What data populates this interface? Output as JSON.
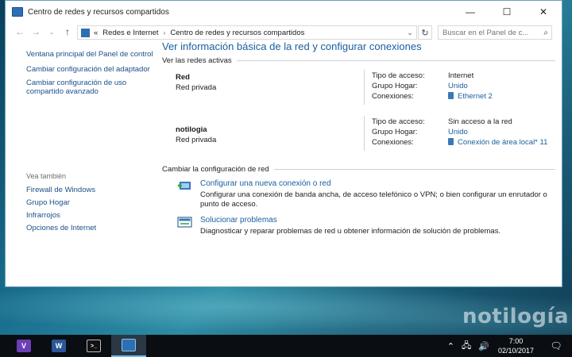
{
  "window": {
    "title": "Centro de redes y recursos compartidos",
    "controls": {
      "minimize": "—",
      "maximize": "☐",
      "close": "✕"
    }
  },
  "address": {
    "prefix": "«",
    "crumbs": [
      "Redes e Internet",
      "Centro de redes y recursos compartidos"
    ],
    "separator": "›",
    "search_placeholder": "Buscar en el Panel de c..."
  },
  "sidebar": {
    "items": [
      {
        "label": "Ventana principal del Panel de control"
      },
      {
        "label": "Cambiar configuración del adaptador"
      },
      {
        "label": "Cambiar configuración de uso compartido avanzado"
      }
    ],
    "see_also_heading": "Vea también",
    "see_also": [
      {
        "label": "Firewall de Windows"
      },
      {
        "label": "Grupo Hogar"
      },
      {
        "label": "Infrarrojos"
      },
      {
        "label": "Opciones de Internet"
      }
    ]
  },
  "main": {
    "heading": "Ver información básica de la red y configurar conexiones",
    "active_networks_heading": "Ver las redes activas",
    "labels": {
      "access_type": "Tipo de acceso:",
      "homegroup": "Grupo Hogar:",
      "connections": "Conexiones:"
    },
    "networks": [
      {
        "name": "Red",
        "type": "Red privada",
        "access": "Internet",
        "homegroup": "Unido",
        "connection": "Ethernet 2"
      },
      {
        "name": "notilogia",
        "type": "Red privada",
        "access": "Sin acceso a la red",
        "homegroup": "Unido",
        "connection": "Conexión de área local* 11"
      }
    ],
    "change_settings_heading": "Cambiar la configuración de red",
    "tasks": [
      {
        "title": "Configurar una nueva conexión o red",
        "desc": "Configurar una conexión de banda ancha, de acceso telefónico o VPN; o bien configurar un enrutador o punto de acceso."
      },
      {
        "title": "Solucionar problemas",
        "desc": "Diagnosticar y reparar problemas de red u obtener información de solución de problemas."
      }
    ]
  },
  "desktop": {
    "watermark": "notilogía"
  },
  "taskbar": {
    "apps": [
      {
        "name": "visual-studio",
        "glyph": "V",
        "color": "#6c3fb5"
      },
      {
        "name": "word",
        "glyph": "W",
        "color": "#2b579a"
      },
      {
        "name": "command-prompt",
        "glyph": ">_",
        "color": "#111111"
      },
      {
        "name": "network-center",
        "glyph": "",
        "color": "#2d6fb3"
      }
    ],
    "time": "7:00",
    "date": "02/10/2017"
  }
}
